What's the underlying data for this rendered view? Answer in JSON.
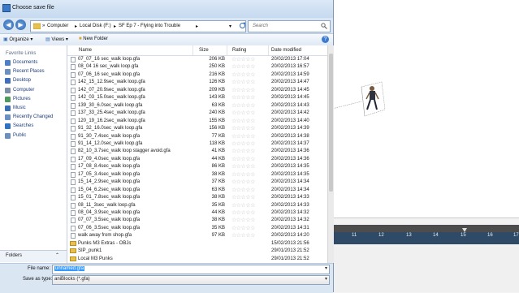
{
  "window": {
    "title": "Choose save file"
  },
  "address": {
    "crumbs": [
      "Computer",
      "Local Disk (F:)",
      "SF Ep 7 - Flying into Trouble"
    ],
    "search_placeholder": "Search"
  },
  "toolbar": {
    "organize": "Organize",
    "views": "Views",
    "new_folder": "New Folder",
    "help": "?"
  },
  "nav": {
    "header": "Favorite Links",
    "items": [
      "Documents",
      "Recent Places",
      "Desktop",
      "Computer",
      "Pictures",
      "Music",
      "Recently Changed",
      "Searches",
      "Public"
    ],
    "folders_label": "Folders"
  },
  "columns": {
    "name": "Name",
    "size": "Size",
    "rating": "Rating",
    "date": "Date modified"
  },
  "files": [
    {
      "name": "07_07_16 sec_walk loop.gfa",
      "size": "206 KB",
      "date": "20/02/2013 17:04",
      "type": "file"
    },
    {
      "name": "08_04 16 sec_walk loop.gfa",
      "size": "250 KB",
      "date": "20/02/2013 16:57",
      "type": "file"
    },
    {
      "name": "07_06_16 sec_walk loop.gfa",
      "size": "216 KB",
      "date": "20/02/2013 14:59",
      "type": "file"
    },
    {
      "name": "142_15_12.9sec_walk loop.gfa",
      "size": "126 KB",
      "date": "20/02/2013 14:47",
      "type": "file"
    },
    {
      "name": "142_07_20.9sec_walk loop.gfa",
      "size": "209 KB",
      "date": "20/02/2013 14:45",
      "type": "file"
    },
    {
      "name": "142_03_15.0sec_walk loop.gfa",
      "size": "143 KB",
      "date": "20/02/2013 14:45",
      "type": "file"
    },
    {
      "name": "139_30_6.0sec_walk loop.gfa",
      "size": "63 KB",
      "date": "20/02/2013 14:43",
      "type": "file"
    },
    {
      "name": "137_33_25.4sec_walk loop.gfa",
      "size": "240 KB",
      "date": "20/02/2013 14:42",
      "type": "file"
    },
    {
      "name": "120_19_16.2sec_walk loop.gfa",
      "size": "155 KB",
      "date": "20/02/2013 14:40",
      "type": "file"
    },
    {
      "name": "91_32_16.0sec_walk loop.gfa",
      "size": "156 KB",
      "date": "20/02/2013 14:39",
      "type": "file"
    },
    {
      "name": "91_30_7.4sec_walk loop.gfa",
      "size": "77 KB",
      "date": "20/02/2013 14:38",
      "type": "file"
    },
    {
      "name": "91_14_12.0sec_walk loop.gfa",
      "size": "118 KB",
      "date": "20/02/2013 14:37",
      "type": "file"
    },
    {
      "name": "82_10_3.7sec_walk loop stagger avoid.gfa",
      "size": "41 KB",
      "date": "20/02/2013 14:36",
      "type": "file"
    },
    {
      "name": "17_09_4.0sec_walk loop.gfa",
      "size": "44 KB",
      "date": "20/02/2013 14:36",
      "type": "file"
    },
    {
      "name": "17_08_8.4sec_walk loop.gfa",
      "size": "86 KB",
      "date": "20/02/2013 14:35",
      "type": "file"
    },
    {
      "name": "17_05_3.4sec_walk loop.gfa",
      "size": "38 KB",
      "date": "20/02/2013 14:35",
      "type": "file"
    },
    {
      "name": "15_14_2.9sec_walk loop.gfa",
      "size": "37 KB",
      "date": "20/02/2013 14:34",
      "type": "file"
    },
    {
      "name": "15_04_6.2sec_walk loop.gfa",
      "size": "63 KB",
      "date": "20/02/2013 14:34",
      "type": "file"
    },
    {
      "name": "15_01_7.8sec_walk loop.gfa",
      "size": "38 KB",
      "date": "20/02/2013 14:33",
      "type": "file"
    },
    {
      "name": "08_11_3sec_walk loop.gfa",
      "size": "35 KB",
      "date": "20/02/2013 14:33",
      "type": "file"
    },
    {
      "name": "08_04_3.9sec_walk loop.gfa",
      "size": "44 KB",
      "date": "20/02/2013 14:32",
      "type": "file"
    },
    {
      "name": "07_07_3.5sec_walk loop.gfa",
      "size": "38 KB",
      "date": "20/02/2013 14:32",
      "type": "file"
    },
    {
      "name": "07_06_3.5sec_walk loop.gfa",
      "size": "35 KB",
      "date": "20/02/2013 14:31",
      "type": "file"
    },
    {
      "name": "walk away from shop.gfa",
      "size": "97 KB",
      "date": "20/02/2013 14:20",
      "type": "file"
    },
    {
      "name": "Punks M3 Extras - OBJs",
      "size": "",
      "date": "15/02/2013 21:56",
      "type": "folder"
    },
    {
      "name": "SIP_punk1",
      "size": "",
      "date": "29/01/2013 21:52",
      "type": "folder"
    },
    {
      "name": "Local M3 Punks",
      "size": "",
      "date": "29/01/2013 21:52",
      "type": "folder"
    }
  ],
  "bottom": {
    "filename_label": "File name:",
    "filename_value": "unnamed.gfa",
    "type_label": "Save as type:",
    "type_value": "aniBlocks (*.gfa)"
  },
  "timeline": {
    "ticks": [
      "11",
      "12",
      "13",
      "14",
      "15",
      "16",
      "17"
    ]
  },
  "colors": {
    "accent": "#3399ff",
    "star_empty": "#b9bfc6",
    "folder": "#e8c04e"
  }
}
